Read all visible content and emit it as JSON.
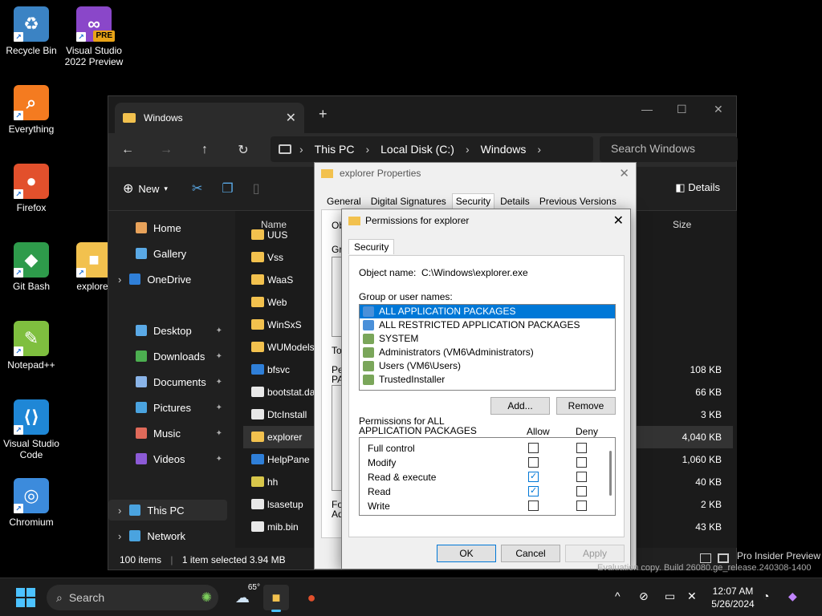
{
  "desktop": {
    "icons": [
      {
        "label": "Recycle Bin",
        "glyph": "♻",
        "color": "#3b83c4"
      },
      {
        "label": "Visual Studio 2022 Preview",
        "glyph": "∞",
        "color": "#8a47c9",
        "badge": "PRE"
      },
      {
        "label": "Everything",
        "glyph": "⌕",
        "color": "#f47b20"
      },
      {
        "label": "Firefox",
        "glyph": "●",
        "color": "#e2502c"
      },
      {
        "label": "Git Bash",
        "glyph": "◆",
        "color": "#2e9b4b"
      },
      {
        "label": "explorer",
        "glyph": "■",
        "color": "#f2c14e"
      },
      {
        "label": "Notepad++",
        "glyph": "✎",
        "color": "#7fbf3f"
      },
      {
        "label": "Visual Studio Code",
        "glyph": "⟨⟩",
        "color": "#1f87d6"
      },
      {
        "label": "Chromium",
        "glyph": "◎",
        "color": "#3c8bdc"
      }
    ]
  },
  "explorer": {
    "tab_title": "Windows",
    "breadcrumb": [
      "This PC",
      "Local Disk (C:)",
      "Windows"
    ],
    "search_placeholder": "Search Windows",
    "new_label": "New",
    "details_label": "Details",
    "sidebar": [
      {
        "label": "Home",
        "color": "#e8a25a"
      },
      {
        "label": "Gallery",
        "color": "#5aa9e6"
      },
      {
        "label": "OneDrive",
        "color": "#2f7fd8",
        "chevron": true
      },
      {
        "label": "Desktop",
        "color": "#5aa9e6",
        "pinned": true
      },
      {
        "label": "Downloads",
        "color": "#4caf50",
        "pinned": true
      },
      {
        "label": "Documents",
        "color": "#8ab4e8",
        "pinned": true
      },
      {
        "label": "Pictures",
        "color": "#4aa3df",
        "pinned": true
      },
      {
        "label": "Music",
        "color": "#e06a5a",
        "pinned": true
      },
      {
        "label": "Videos",
        "color": "#8c5ad6",
        "pinned": true
      },
      {
        "label": "This PC",
        "color": "#4aa3df",
        "chevron": true,
        "selected": true
      },
      {
        "label": "Network",
        "color": "#4aa3df",
        "chevron": true
      }
    ],
    "columns": {
      "name": "Name",
      "size": "Size"
    },
    "files": [
      {
        "name": "UUS",
        "size": "",
        "color": "#f2c14e"
      },
      {
        "name": "Vss",
        "size": "",
        "color": "#f2c14e"
      },
      {
        "name": "WaaS",
        "size": "",
        "color": "#f2c14e"
      },
      {
        "name": "Web",
        "size": "",
        "color": "#f2c14e"
      },
      {
        "name": "WinSxS",
        "size": "",
        "color": "#f2c14e"
      },
      {
        "name": "WUModels",
        "size": "",
        "color": "#f2c14e"
      },
      {
        "name": "bfsvc",
        "size": "108 KB",
        "color": "#2f7fd8"
      },
      {
        "name": "bootstat.da",
        "size": "66 KB",
        "color": "#e8e8e8"
      },
      {
        "name": "DtcInstall",
        "size": "3 KB",
        "color": "#e8e8e8"
      },
      {
        "name": "explorer",
        "size": "4,040 KB",
        "color": "#f2c14e",
        "selected": true
      },
      {
        "name": "HelpPane",
        "size": "1,060 KB",
        "color": "#2f7fd8"
      },
      {
        "name": "hh",
        "size": "40 KB",
        "color": "#d8c64a"
      },
      {
        "name": "lsasetup",
        "size": "2 KB",
        "color": "#e8e8e8"
      },
      {
        "name": "mib.bin",
        "size": "43 KB",
        "color": "#e8e8e8"
      }
    ],
    "status": {
      "count": "100 items",
      "selection": "1 item selected  3.94 MB"
    }
  },
  "properties": {
    "title": "explorer Properties",
    "tabs": [
      "General",
      "Digital Signatures",
      "Security",
      "Details",
      "Previous Versions"
    ],
    "selected_tab": "Security",
    "fragments": [
      "Ob",
      "Gr",
      "To",
      "Pe",
      "PA",
      "Fo",
      "Ad"
    ]
  },
  "permissions": {
    "title": "Permissions for explorer",
    "tab": "Security",
    "object_label": "Object name:",
    "object_value": "C:\\Windows\\explorer.exe",
    "group_label": "Group or user names:",
    "groups": [
      {
        "name": "ALL APPLICATION PACKAGES",
        "color": "#4a90d9",
        "selected": true
      },
      {
        "name": "ALL RESTRICTED APPLICATION PACKAGES",
        "color": "#4a90d9"
      },
      {
        "name": "SYSTEM",
        "color": "#7aa65a"
      },
      {
        "name": "Administrators (VM6\\Administrators)",
        "color": "#7aa65a"
      },
      {
        "name": "Users (VM6\\Users)",
        "color": "#7aa65a"
      },
      {
        "name": "TrustedInstaller",
        "color": "#7aa65a"
      }
    ],
    "add_label": "Add...",
    "remove_label": "Remove",
    "perm_for_label": "Permissions for ALL\nAPPLICATION PACKAGES",
    "allow_label": "Allow",
    "deny_label": "Deny",
    "rows": [
      {
        "name": "Full control",
        "allow": false,
        "deny": false
      },
      {
        "name": "Modify",
        "allow": false,
        "deny": false
      },
      {
        "name": "Read & execute",
        "allow": true,
        "deny": false
      },
      {
        "name": "Read",
        "allow": true,
        "deny": false
      },
      {
        "name": "Write",
        "allow": false,
        "deny": false
      }
    ],
    "ok_label": "OK",
    "cancel_label": "Cancel",
    "apply_label": "Apply"
  },
  "watermark": {
    "line1": "Pro Insider Preview",
    "line2": "Evaluation copy. Build 26080.ge_release.240308-1400"
  },
  "taskbar": {
    "search_label": "Search",
    "weather": "65°",
    "time": "12:07 AM",
    "date": "5/26/2024"
  }
}
